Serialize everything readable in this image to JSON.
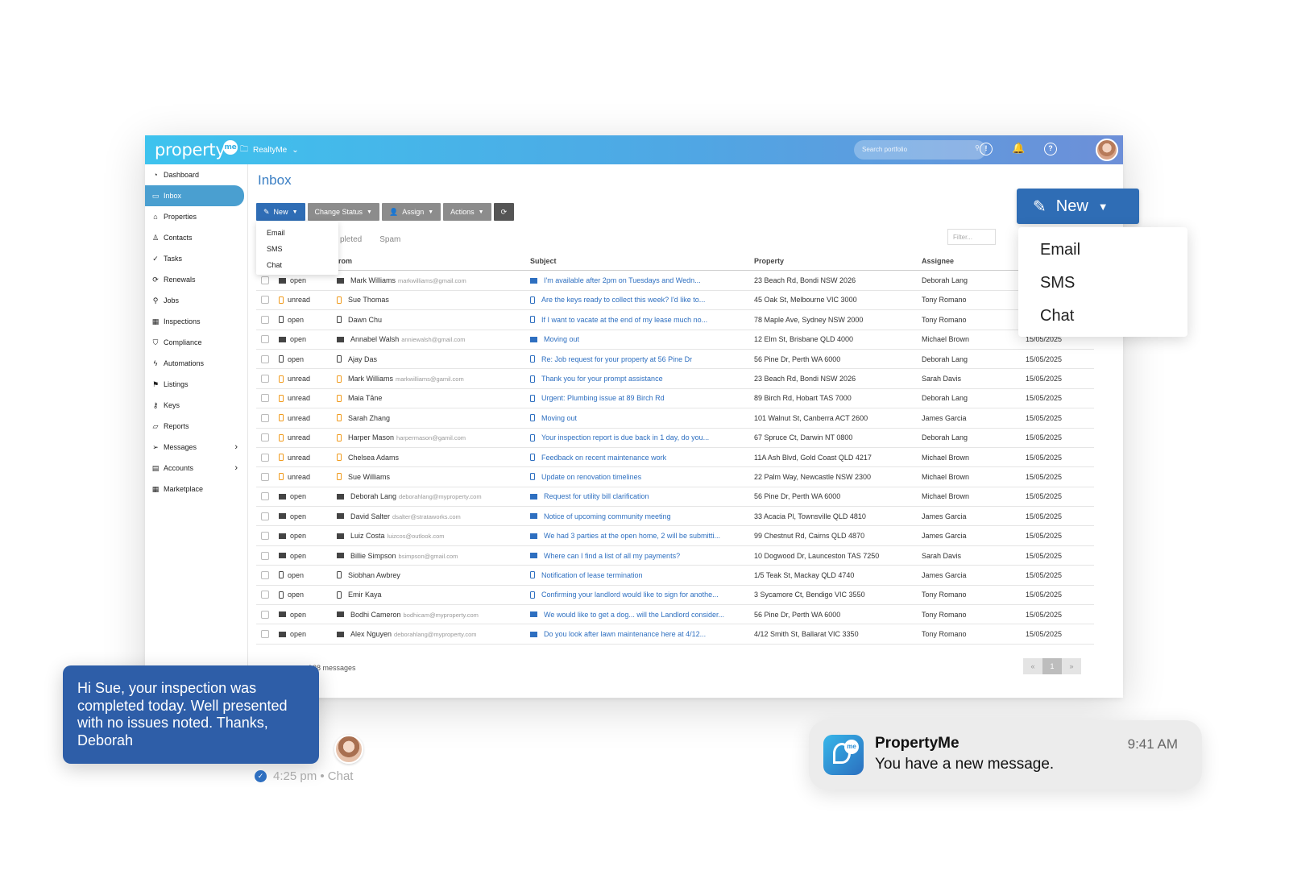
{
  "app": {
    "logo": "property",
    "logo_badge": "me",
    "workspace": "RealtyMe",
    "search_placeholder": "Search portfolio"
  },
  "sidebar": {
    "items": [
      {
        "label": "Dashboard",
        "icon": "dashboard-icon"
      },
      {
        "label": "Inbox",
        "icon": "inbox-icon",
        "active": true
      },
      {
        "label": "Properties",
        "icon": "home-icon"
      },
      {
        "label": "Contacts",
        "icon": "user-icon"
      },
      {
        "label": "Tasks",
        "icon": "check-circle-icon"
      },
      {
        "label": "Renewals",
        "icon": "refresh-icon"
      },
      {
        "label": "Jobs",
        "icon": "wrench-icon"
      },
      {
        "label": "Inspections",
        "icon": "calendar-icon"
      },
      {
        "label": "Compliance",
        "icon": "shield-icon"
      },
      {
        "label": "Automations",
        "icon": "bolt-icon"
      },
      {
        "label": "Listings",
        "icon": "signpost-icon"
      },
      {
        "label": "Keys",
        "icon": "key-icon"
      },
      {
        "label": "Reports",
        "icon": "folder-icon"
      },
      {
        "label": "Messages",
        "icon": "send-icon",
        "has_children": true
      },
      {
        "label": "Accounts",
        "icon": "ledger-icon",
        "has_children": true
      },
      {
        "label": "Marketplace",
        "icon": "grid-icon"
      }
    ]
  },
  "main": {
    "title": "Inbox",
    "toolbar": {
      "new": "New",
      "change_status": "Change Status",
      "assign": "Assign",
      "actions": "Actions"
    },
    "new_menu": [
      "Email",
      "SMS",
      "Chat"
    ],
    "tabs": [
      "pleted",
      "Spam"
    ],
    "filter_placeholder": "Filter...",
    "columns": {
      "from": "rom",
      "subject": "Subject",
      "property": "Property",
      "assignee": "Assignee"
    },
    "rows": [
      {
        "channel": "email",
        "status": "open",
        "from": "Mark Williams",
        "email": "markwilliams@gmail.com",
        "subject": "I'm available after 2pm on Tuesdays and Wedn...",
        "property": "23 Beach Rd, Bondi NSW 2026",
        "assignee": "Deborah Lang",
        "date": ""
      },
      {
        "channel": "sms",
        "status": "unread",
        "from": "Sue Thomas",
        "email": "",
        "subject": "Are the keys ready to collect this week? I'd like to...",
        "property": "45 Oak St, Melbourne VIC 3000",
        "assignee": "Tony Romano",
        "date": ""
      },
      {
        "channel": "sms",
        "status": "open",
        "from": "Dawn Chu",
        "email": "",
        "subject": "If I want to vacate at the end of my lease much no...",
        "property": "78 Maple Ave, Sydney NSW 2000",
        "assignee": "Tony Romano",
        "date": ""
      },
      {
        "channel": "email",
        "status": "open",
        "from": "Annabel Walsh",
        "email": "anniewalsh@gmail.com",
        "subject": "Moving out",
        "property": "12 Elm St, Brisbane QLD 4000",
        "assignee": "Michael Brown",
        "date": "15/05/2025"
      },
      {
        "channel": "sms",
        "status": "open",
        "from": "Ajay Das",
        "email": "",
        "subject": "Re: Job request for your property at 56 Pine Dr",
        "property": "56 Pine Dr, Perth WA 6000",
        "assignee": "Deborah Lang",
        "date": "15/05/2025"
      },
      {
        "channel": "sms",
        "status": "unread",
        "from": "Mark Williams",
        "email": "markwilliams@gamil.com",
        "subject": "Thank you for your prompt assistance",
        "property": "23 Beach Rd, Bondi NSW 2026",
        "assignee": "Sarah Davis",
        "date": "15/05/2025"
      },
      {
        "channel": "sms",
        "status": "unread",
        "from": "Maia Tāne",
        "email": "",
        "subject": "Urgent: Plumbing issue at 89 Birch Rd",
        "property": "89 Birch Rd, Hobart TAS 7000",
        "assignee": "Deborah Lang",
        "date": "15/05/2025"
      },
      {
        "channel": "sms",
        "status": "unread",
        "from": "Sarah Zhang",
        "email": "",
        "subject": "Moving out",
        "property": "101 Walnut St, Canberra ACT 2600",
        "assignee": "James Garcia",
        "date": "15/05/2025"
      },
      {
        "channel": "sms",
        "status": "unread",
        "from": "Harper Mason",
        "email": "harpermason@gamil.com",
        "subject": "Your inspection report is due back in 1 day, do you...",
        "property": "67 Spruce Ct, Darwin NT 0800",
        "assignee": "Deborah Lang",
        "date": "15/05/2025"
      },
      {
        "channel": "sms",
        "status": "unread",
        "from": "Chelsea Adams",
        "email": "",
        "subject": "Feedback on recent maintenance work",
        "property": "11A Ash Blvd, Gold Coast QLD 4217",
        "assignee": "Michael Brown",
        "date": "15/05/2025"
      },
      {
        "channel": "sms",
        "status": "unread",
        "from": "Sue Williams",
        "email": "",
        "subject": "Update on renovation timelines",
        "property": "22 Palm Way, Newcastle NSW 2300",
        "assignee": "Michael Brown",
        "date": "15/05/2025"
      },
      {
        "channel": "email",
        "status": "open",
        "from": "Deborah Lang",
        "email": "deborahlang@myproperty.com",
        "subject": "Request for utility bill clarification",
        "property": "56 Pine Dr, Perth WA 6000",
        "assignee": "Michael Brown",
        "date": "15/05/2025"
      },
      {
        "channel": "email",
        "status": "open",
        "from": "David Salter",
        "email": "dsalter@strataworks.com",
        "subject": "Notice of upcoming community meeting",
        "property": "33 Acacia Pl, Townsville QLD 4810",
        "assignee": "James Garcia",
        "date": "15/05/2025"
      },
      {
        "channel": "email",
        "status": "open",
        "from": "Luiz Costa",
        "email": "luizcos@outlook.com",
        "subject": "We had 3 parties at the open home, 2 will be submitti...",
        "property": "99 Chestnut Rd, Cairns QLD 4870",
        "assignee": "James Garcia",
        "date": "15/05/2025"
      },
      {
        "channel": "email",
        "status": "open",
        "from": "Billie Simpson",
        "email": "bsimpson@gmail.com",
        "subject": "Where can I find a list of all my payments?",
        "property": "10 Dogwood Dr, Launceston TAS 7250",
        "assignee": "Sarah Davis",
        "date": "15/05/2025"
      },
      {
        "channel": "sms",
        "status": "open",
        "from": "Siobhan Awbrey",
        "email": "",
        "subject": "Notification of lease termination",
        "property": "1/5 Teak St, Mackay QLD 4740",
        "assignee": "James Garcia",
        "date": "15/05/2025"
      },
      {
        "channel": "sms",
        "status": "open",
        "from": "Emir Kaya",
        "email": "",
        "subject": "Confirming your landlord would like to sign for anothe...",
        "property": "3 Sycamore Ct, Bendigo VIC 3550",
        "assignee": "Tony Romano",
        "date": "15/05/2025"
      },
      {
        "channel": "email",
        "status": "open",
        "from": "Bodhi Cameron",
        "email": "bodhicam@myproperty.com",
        "subject": "We would like to get a dog... will the Landlord consider...",
        "property": "56 Pine Dr, Perth WA 6000",
        "assignee": "Tony Romano",
        "date": "15/05/2025"
      },
      {
        "channel": "email",
        "status": "open",
        "from": "Alex Nguyen",
        "email": "deborahlang@myproperty.com",
        "subject": "Do you look after lawn maintenance here at 4/12...",
        "property": "4/12 Smith St, Ballarat VIC 3350",
        "assignee": "Tony Romano",
        "date": "15/05/2025"
      }
    ],
    "footer_count": "of 28 messages",
    "pager": {
      "prev": "«",
      "current": "1",
      "next": "»"
    }
  },
  "overlay_new": {
    "label": "New",
    "menu": [
      "Email",
      "SMS",
      "Chat"
    ]
  },
  "chat": {
    "message": "Hi Sue, your inspection was completed today. Well presented with no issues noted. Thanks, Deborah",
    "meta": "4:25 pm • Chat"
  },
  "notification": {
    "app": "PropertyMe",
    "body": "You have a new message.",
    "time": "9:41 AM"
  },
  "colors": {
    "accent": "#2f6db5",
    "link": "#2e6fc0",
    "sms_unread": "#f09a1b",
    "topbar_start": "#3ec3ee",
    "topbar_end": "#6d8fd8"
  }
}
